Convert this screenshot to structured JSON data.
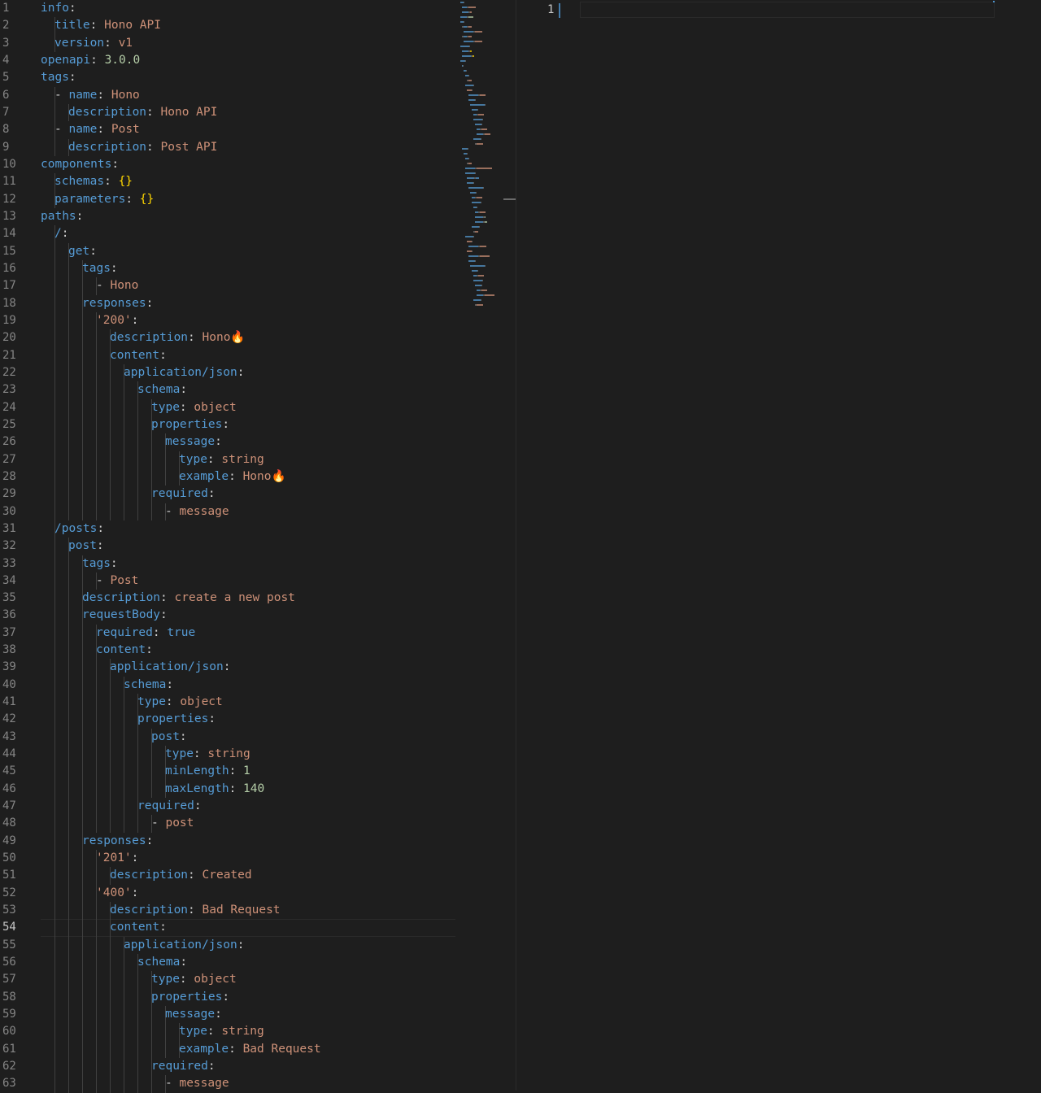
{
  "left_editor": {
    "active_line": 54,
    "lines": [
      {
        "n": "1",
        "indent": 0,
        "t": [
          [
            "k",
            "info"
          ],
          [
            "p",
            ":"
          ]
        ]
      },
      {
        "n": "2",
        "indent": 1,
        "t": [
          [
            "k",
            "title"
          ],
          [
            "p",
            ": "
          ],
          [
            "s",
            "Hono API"
          ]
        ]
      },
      {
        "n": "3",
        "indent": 1,
        "t": [
          [
            "k",
            "version"
          ],
          [
            "p",
            ": "
          ],
          [
            "s",
            "v1"
          ]
        ]
      },
      {
        "n": "4",
        "indent": 0,
        "t": [
          [
            "k",
            "openapi"
          ],
          [
            "p",
            ": "
          ],
          [
            "n",
            "3.0.0"
          ]
        ]
      },
      {
        "n": "5",
        "indent": 0,
        "t": [
          [
            "k",
            "tags"
          ],
          [
            "p",
            ":"
          ]
        ]
      },
      {
        "n": "6",
        "indent": 1,
        "t": [
          [
            "d",
            "- "
          ],
          [
            "k",
            "name"
          ],
          [
            "p",
            ": "
          ],
          [
            "s",
            "Hono"
          ]
        ]
      },
      {
        "n": "7",
        "indent": 2,
        "t": [
          [
            "k",
            "description"
          ],
          [
            "p",
            ": "
          ],
          [
            "s",
            "Hono API"
          ]
        ]
      },
      {
        "n": "8",
        "indent": 1,
        "t": [
          [
            "d",
            "- "
          ],
          [
            "k",
            "name"
          ],
          [
            "p",
            ": "
          ],
          [
            "s",
            "Post"
          ]
        ]
      },
      {
        "n": "9",
        "indent": 2,
        "t": [
          [
            "k",
            "description"
          ],
          [
            "p",
            ": "
          ],
          [
            "s",
            "Post API"
          ]
        ]
      },
      {
        "n": "10",
        "indent": 0,
        "t": [
          [
            "k",
            "components"
          ],
          [
            "p",
            ":"
          ]
        ]
      },
      {
        "n": "11",
        "indent": 1,
        "t": [
          [
            "k",
            "schemas"
          ],
          [
            "p",
            ": "
          ],
          [
            "b",
            "{}"
          ]
        ]
      },
      {
        "n": "12",
        "indent": 1,
        "t": [
          [
            "k",
            "parameters"
          ],
          [
            "p",
            ": "
          ],
          [
            "b",
            "{}"
          ]
        ]
      },
      {
        "n": "13",
        "indent": 0,
        "t": [
          [
            "k",
            "paths"
          ],
          [
            "p",
            ":"
          ]
        ]
      },
      {
        "n": "14",
        "indent": 1,
        "t": [
          [
            "k",
            "/"
          ],
          [
            "p",
            ":"
          ]
        ]
      },
      {
        "n": "15",
        "indent": 2,
        "t": [
          [
            "k",
            "get"
          ],
          [
            "p",
            ":"
          ]
        ]
      },
      {
        "n": "16",
        "indent": 3,
        "t": [
          [
            "k",
            "tags"
          ],
          [
            "p",
            ":"
          ]
        ]
      },
      {
        "n": "17",
        "indent": 4,
        "t": [
          [
            "d",
            "- "
          ],
          [
            "s",
            "Hono"
          ]
        ]
      },
      {
        "n": "18",
        "indent": 3,
        "t": [
          [
            "k",
            "responses"
          ],
          [
            "p",
            ":"
          ]
        ]
      },
      {
        "n": "19",
        "indent": 4,
        "t": [
          [
            "s",
            "'200'"
          ],
          [
            "p",
            ":"
          ]
        ]
      },
      {
        "n": "20",
        "indent": 5,
        "t": [
          [
            "k",
            "description"
          ],
          [
            "p",
            ": "
          ],
          [
            "s",
            "Hono🔥"
          ]
        ]
      },
      {
        "n": "21",
        "indent": 5,
        "t": [
          [
            "k",
            "content"
          ],
          [
            "p",
            ":"
          ]
        ]
      },
      {
        "n": "22",
        "indent": 6,
        "t": [
          [
            "k",
            "application/json"
          ],
          [
            "p",
            ":"
          ]
        ]
      },
      {
        "n": "23",
        "indent": 7,
        "t": [
          [
            "k",
            "schema"
          ],
          [
            "p",
            ":"
          ]
        ]
      },
      {
        "n": "24",
        "indent": 8,
        "t": [
          [
            "k",
            "type"
          ],
          [
            "p",
            ": "
          ],
          [
            "s",
            "object"
          ]
        ]
      },
      {
        "n": "25",
        "indent": 8,
        "t": [
          [
            "k",
            "properties"
          ],
          [
            "p",
            ":"
          ]
        ]
      },
      {
        "n": "26",
        "indent": 9,
        "t": [
          [
            "k",
            "message"
          ],
          [
            "p",
            ":"
          ]
        ]
      },
      {
        "n": "27",
        "indent": 10,
        "t": [
          [
            "k",
            "type"
          ],
          [
            "p",
            ": "
          ],
          [
            "s",
            "string"
          ]
        ]
      },
      {
        "n": "28",
        "indent": 10,
        "t": [
          [
            "k",
            "example"
          ],
          [
            "p",
            ": "
          ],
          [
            "s",
            "Hono🔥"
          ]
        ]
      },
      {
        "n": "29",
        "indent": 8,
        "t": [
          [
            "k",
            "required"
          ],
          [
            "p",
            ":"
          ]
        ]
      },
      {
        "n": "30",
        "indent": 9,
        "t": [
          [
            "d",
            "- "
          ],
          [
            "s",
            "message"
          ]
        ]
      },
      {
        "n": "31",
        "indent": 1,
        "t": [
          [
            "k",
            "/posts"
          ],
          [
            "p",
            ":"
          ]
        ]
      },
      {
        "n": "32",
        "indent": 2,
        "t": [
          [
            "k",
            "post"
          ],
          [
            "p",
            ":"
          ]
        ]
      },
      {
        "n": "33",
        "indent": 3,
        "t": [
          [
            "k",
            "tags"
          ],
          [
            "p",
            ":"
          ]
        ]
      },
      {
        "n": "34",
        "indent": 4,
        "t": [
          [
            "d",
            "- "
          ],
          [
            "s",
            "Post"
          ]
        ]
      },
      {
        "n": "35",
        "indent": 3,
        "t": [
          [
            "k",
            "description"
          ],
          [
            "p",
            ": "
          ],
          [
            "s",
            "create a new post"
          ]
        ]
      },
      {
        "n": "36",
        "indent": 3,
        "t": [
          [
            "k",
            "requestBody"
          ],
          [
            "p",
            ":"
          ]
        ]
      },
      {
        "n": "37",
        "indent": 4,
        "t": [
          [
            "k",
            "required"
          ],
          [
            "p",
            ": "
          ],
          [
            "k",
            "true"
          ]
        ]
      },
      {
        "n": "38",
        "indent": 4,
        "t": [
          [
            "k",
            "content"
          ],
          [
            "p",
            ":"
          ]
        ]
      },
      {
        "n": "39",
        "indent": 5,
        "t": [
          [
            "k",
            "application/json"
          ],
          [
            "p",
            ":"
          ]
        ]
      },
      {
        "n": "40",
        "indent": 6,
        "t": [
          [
            "k",
            "schema"
          ],
          [
            "p",
            ":"
          ]
        ]
      },
      {
        "n": "41",
        "indent": 7,
        "t": [
          [
            "k",
            "type"
          ],
          [
            "p",
            ": "
          ],
          [
            "s",
            "object"
          ]
        ]
      },
      {
        "n": "42",
        "indent": 7,
        "t": [
          [
            "k",
            "properties"
          ],
          [
            "p",
            ":"
          ]
        ]
      },
      {
        "n": "43",
        "indent": 8,
        "t": [
          [
            "k",
            "post"
          ],
          [
            "p",
            ":"
          ]
        ]
      },
      {
        "n": "44",
        "indent": 9,
        "t": [
          [
            "k",
            "type"
          ],
          [
            "p",
            ": "
          ],
          [
            "s",
            "string"
          ]
        ]
      },
      {
        "n": "45",
        "indent": 9,
        "t": [
          [
            "k",
            "minLength"
          ],
          [
            "p",
            ": "
          ],
          [
            "n",
            "1"
          ]
        ]
      },
      {
        "n": "46",
        "indent": 9,
        "t": [
          [
            "k",
            "maxLength"
          ],
          [
            "p",
            ": "
          ],
          [
            "n",
            "140"
          ]
        ]
      },
      {
        "n": "47",
        "indent": 7,
        "t": [
          [
            "k",
            "required"
          ],
          [
            "p",
            ":"
          ]
        ]
      },
      {
        "n": "48",
        "indent": 8,
        "t": [
          [
            "d",
            "- "
          ],
          [
            "s",
            "post"
          ]
        ]
      },
      {
        "n": "49",
        "indent": 3,
        "t": [
          [
            "k",
            "responses"
          ],
          [
            "p",
            ":"
          ]
        ]
      },
      {
        "n": "50",
        "indent": 4,
        "t": [
          [
            "s",
            "'201'"
          ],
          [
            "p",
            ":"
          ]
        ]
      },
      {
        "n": "51",
        "indent": 5,
        "t": [
          [
            "k",
            "description"
          ],
          [
            "p",
            ": "
          ],
          [
            "s",
            "Created"
          ]
        ]
      },
      {
        "n": "52",
        "indent": 4,
        "t": [
          [
            "s",
            "'400'"
          ],
          [
            "p",
            ":"
          ]
        ]
      },
      {
        "n": "53",
        "indent": 5,
        "t": [
          [
            "k",
            "description"
          ],
          [
            "p",
            ": "
          ],
          [
            "s",
            "Bad Request"
          ]
        ]
      },
      {
        "n": "54",
        "indent": 5,
        "t": [
          [
            "k",
            "content"
          ],
          [
            "p",
            ":"
          ]
        ]
      },
      {
        "n": "55",
        "indent": 6,
        "t": [
          [
            "k",
            "application/json"
          ],
          [
            "p",
            ":"
          ]
        ]
      },
      {
        "n": "56",
        "indent": 7,
        "t": [
          [
            "k",
            "schema"
          ],
          [
            "p",
            ":"
          ]
        ]
      },
      {
        "n": "57",
        "indent": 8,
        "t": [
          [
            "k",
            "type"
          ],
          [
            "p",
            ": "
          ],
          [
            "s",
            "object"
          ]
        ]
      },
      {
        "n": "58",
        "indent": 8,
        "t": [
          [
            "k",
            "properties"
          ],
          [
            "p",
            ":"
          ]
        ]
      },
      {
        "n": "59",
        "indent": 9,
        "t": [
          [
            "k",
            "message"
          ],
          [
            "p",
            ":"
          ]
        ]
      },
      {
        "n": "60",
        "indent": 10,
        "t": [
          [
            "k",
            "type"
          ],
          [
            "p",
            ": "
          ],
          [
            "s",
            "string"
          ]
        ]
      },
      {
        "n": "61",
        "indent": 10,
        "t": [
          [
            "k",
            "example"
          ],
          [
            "p",
            ": "
          ],
          [
            "s",
            "Bad Request"
          ]
        ]
      },
      {
        "n": "62",
        "indent": 8,
        "t": [
          [
            "k",
            "required"
          ],
          [
            "p",
            ":"
          ]
        ]
      },
      {
        "n": "63",
        "indent": 9,
        "t": [
          [
            "d",
            "- "
          ],
          [
            "s",
            "message"
          ]
        ]
      }
    ]
  },
  "right_editor": {
    "line_number": "1"
  },
  "colors": {
    "background": "#1e1e1e",
    "key": "#569cd6",
    "string": "#ce9178",
    "number": "#b5cea8",
    "bracket": "#ffd700",
    "line_number": "#858585"
  }
}
